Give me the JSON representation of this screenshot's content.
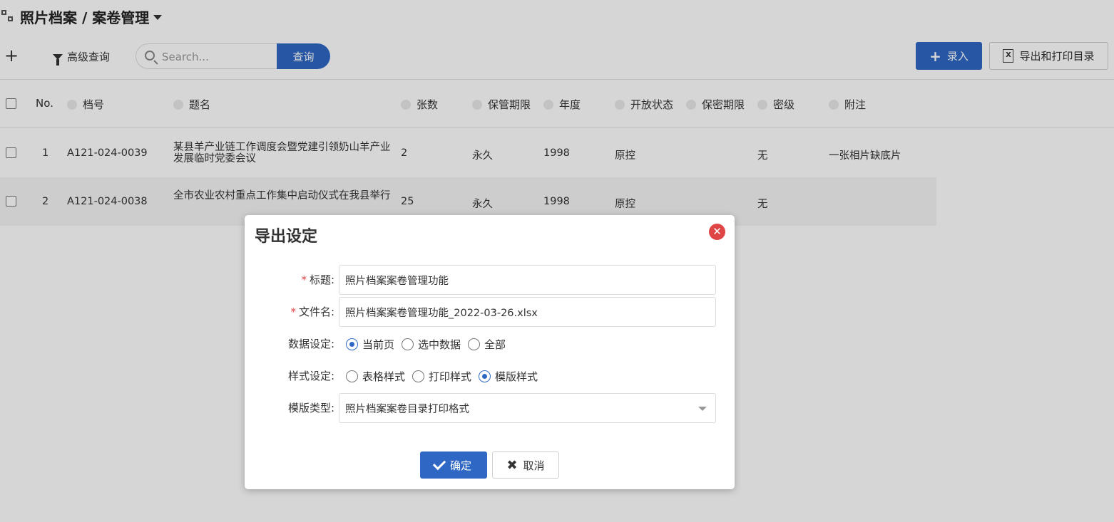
{
  "header": {
    "title": "照片档案 / 案卷管理"
  },
  "toolbar": {
    "add_symbol": "+",
    "advanced_search_label": "高级查询",
    "search_placeholder": "Search...",
    "query_label": "查询",
    "enter_label": "录入",
    "export_label": "导出和打印目录",
    "xls_glyph": "X"
  },
  "table": {
    "columns": [
      "No.",
      "档号",
      "题名",
      "张数",
      "保管期限",
      "年度",
      "开放状态",
      "保密期限",
      "密级",
      "附注"
    ],
    "rows": [
      {
        "no": "1",
        "code": "A121-024-0039",
        "title": "某县羊产业链工作调度会暨党建引领奶山羊产业发展临时党委会议",
        "count": "2",
        "retention": "永久",
        "year": "1998",
        "status": "原控",
        "secret_period": "",
        "level": "无",
        "note": "一张相片缺底片"
      },
      {
        "no": "2",
        "code": "A121-024-0038",
        "title": "全市农业农村重点工作集中启动仪式在我县举行",
        "count": "25",
        "retention": "永久",
        "year": "1998",
        "status": "原控",
        "secret_period": "",
        "level": "无",
        "note": ""
      }
    ]
  },
  "dialog": {
    "title": "导出设定",
    "close_glyph": "✕",
    "required_mark": "*",
    "fields": {
      "title_label": "标题:",
      "title_value": "照片档案案卷管理功能",
      "filename_label": "文件名:",
      "filename_value": "照片档案案卷管理功能_2022-03-26.xlsx",
      "data_label": "数据设定:",
      "data_options": [
        "当前页",
        "选中数据",
        "全部"
      ],
      "data_selected": "当前页",
      "style_label": "样式设定:",
      "style_options": [
        "表格样式",
        "打印样式",
        "模版样式"
      ],
      "style_selected": "模版样式",
      "template_label": "模版类型:",
      "template_value": "照片档案案卷目录打印格式"
    },
    "ok_label": "确定",
    "cancel_label": "取消",
    "cancel_glyph": "✖"
  },
  "colors": {
    "primary": "#2f68c4",
    "danger": "#e04545",
    "overlay": "rgba(0,0,0,0.16)"
  }
}
